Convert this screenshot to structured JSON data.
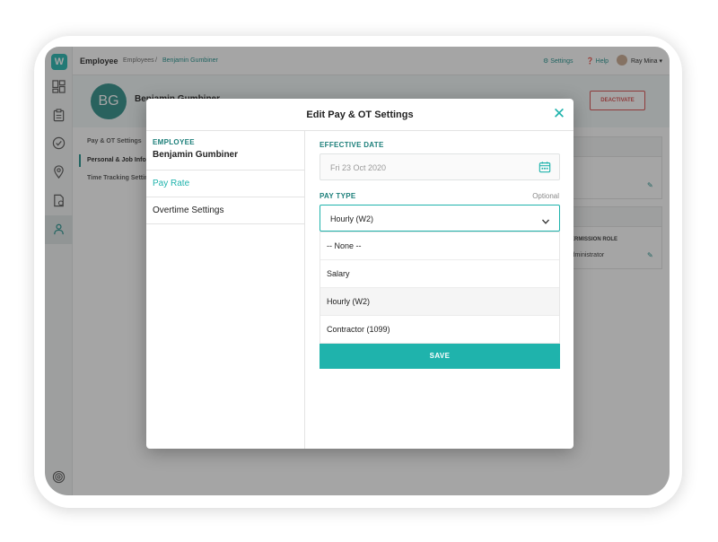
{
  "app": {
    "logo_letter": "W",
    "title": "Employee",
    "breadcrumb": [
      "Employees",
      "Benjamin Gumbiner"
    ],
    "breadcrumb_sep": "/",
    "settings_label": "Settings",
    "help_label": "Help",
    "user_name": "Ray Mina",
    "accent": "#1fb3ac"
  },
  "profile": {
    "initials": "BG",
    "name": "Benjamin Gumbiner",
    "deactivate_label": "DEACTIVATE",
    "nav": [
      "Pay & OT Settings",
      "Personal & Job Info",
      "Time Tracking Settings"
    ],
    "permission_role_label": "PERMISSION ROLE",
    "permission_role_value": "Administrator"
  },
  "sidebar_icons": [
    "dashboard-icon",
    "clipboard-icon",
    "check-circle-icon",
    "location-pin-icon",
    "document-icon",
    "people-icon",
    "fingerprint-icon"
  ],
  "modal": {
    "title": "Edit Pay & OT Settings",
    "close_glyph": "✕",
    "employee_label": "EMPLOYEE",
    "employee_name": "Benjamin Gumbiner",
    "menu": [
      {
        "label": "Pay Rate",
        "active": true
      },
      {
        "label": "Overtime Settings",
        "active": false
      }
    ],
    "effective_date_label": "EFFECTIVE DATE",
    "effective_date_value": "Fri 23 Oct 2020",
    "pay_type_label": "PAY TYPE",
    "pay_type_optional": "Optional",
    "pay_type_selected": "Hourly (W2)",
    "pay_type_options": [
      "-- None --",
      "Salary",
      "Hourly (W2)",
      "Contractor (1099)"
    ],
    "save_label": "SAVE"
  }
}
